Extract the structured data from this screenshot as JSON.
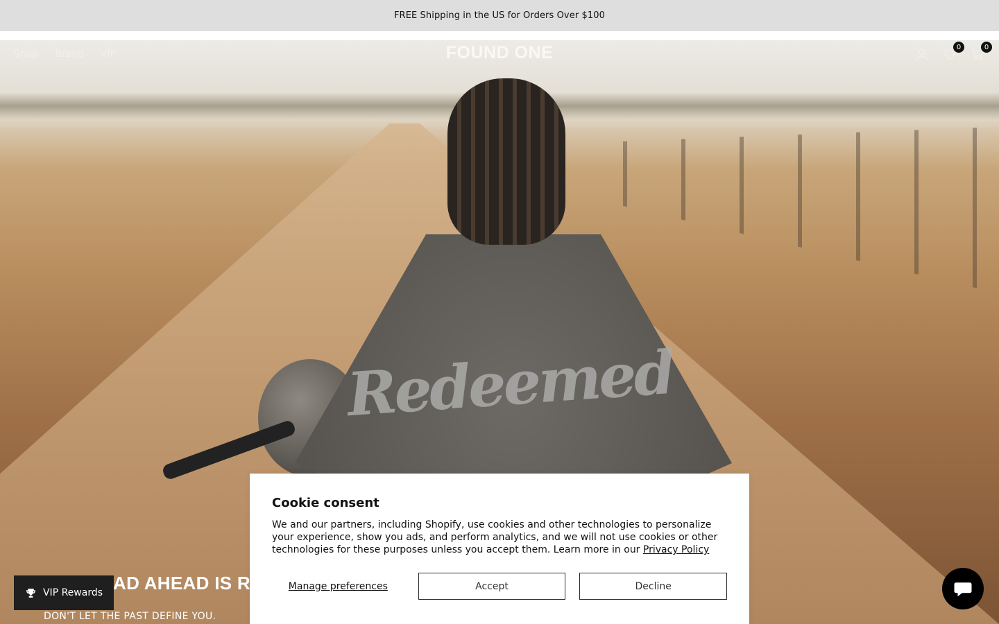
{
  "announcement": {
    "text": "FREE Shipping in the US for Orders Over $100"
  },
  "header": {
    "logo": "FOUND ONE",
    "nav": [
      {
        "label": "Shop"
      },
      {
        "label": "Brand"
      },
      {
        "label": "VIP"
      }
    ],
    "icons": {
      "account": "user-icon",
      "wishlist": "heart-icon",
      "cart": "cart-icon"
    },
    "wishlist_count": "0",
    "cart_count": "0"
  },
  "hero": {
    "shirt_print": "Redeemed",
    "headline": "THE ROAD AHEAD IS RE",
    "subheadline": "DON'T LET THE PAST DEFINE YOU."
  },
  "vip": {
    "label": "VIP Rewards",
    "icon": "trophy-icon"
  },
  "cookie": {
    "title": "Cookie consent",
    "body": "We and our partners, including Shopify, use cookies and other technologies to personalize your experience, show you ads, and perform analytics, and we will not use cookies or other technologies for these purposes unless you accept them. Learn more in our ",
    "policy_link": "Privacy Policy",
    "manage_label": "Manage preferences",
    "accept_label": "Accept",
    "decline_label": "Decline"
  },
  "chat": {
    "icon": "chat-icon"
  },
  "colors": {
    "announcement_bg": "#dedede",
    "dark": "#1f1f1f",
    "white": "#ffffff"
  }
}
